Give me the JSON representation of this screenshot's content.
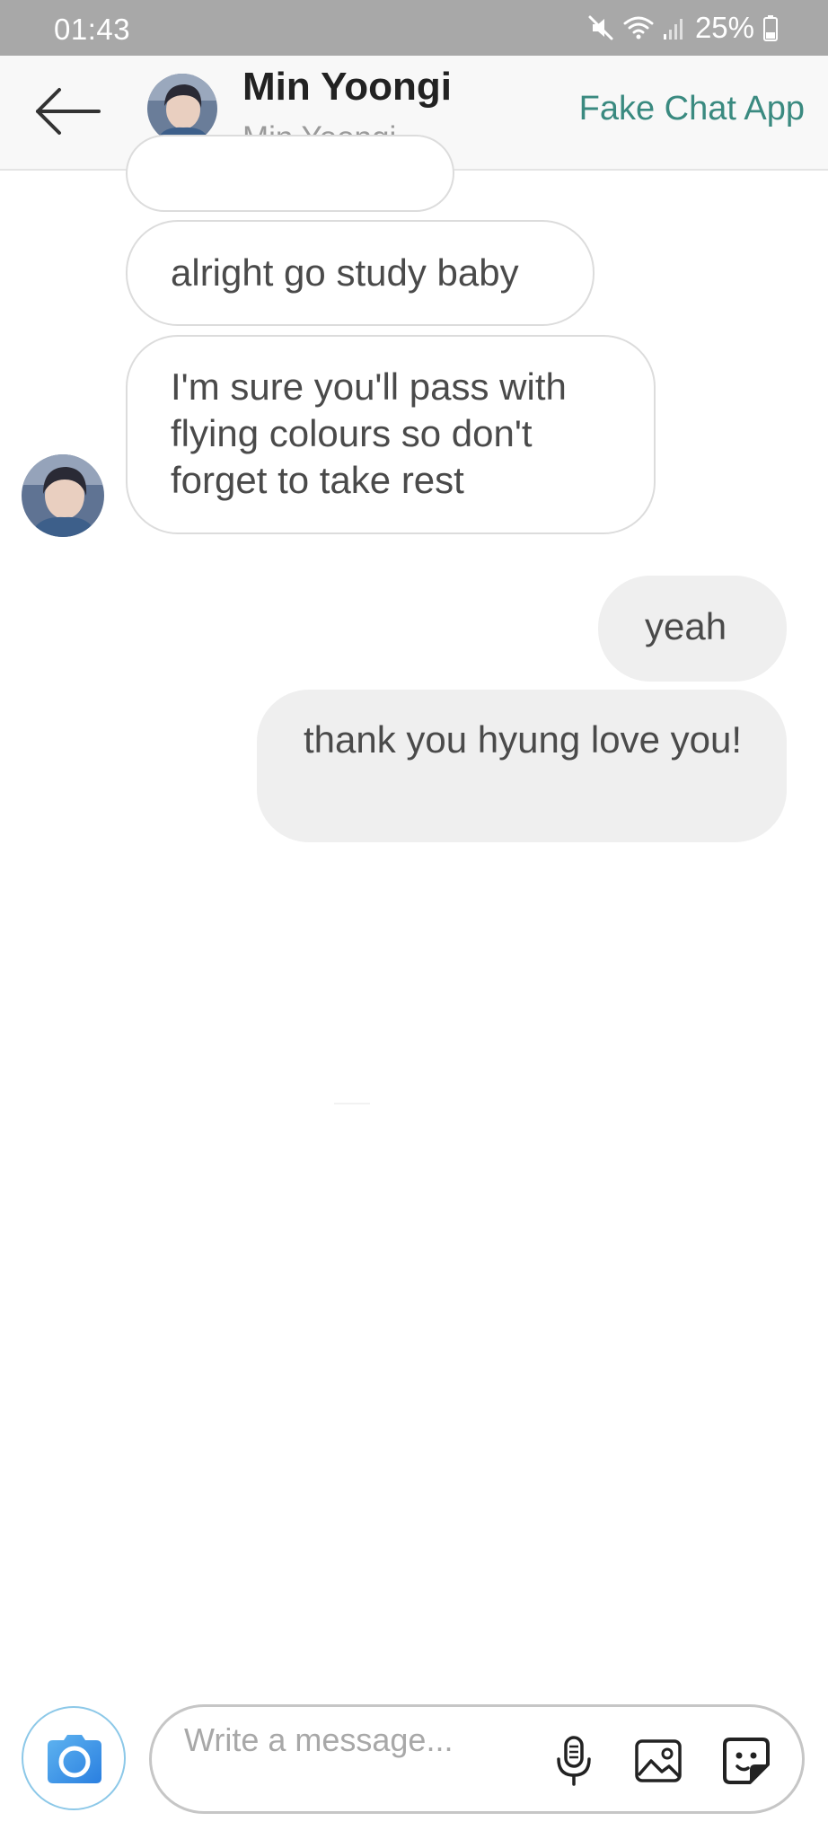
{
  "status_bar": {
    "time": "01:43",
    "battery": "25%",
    "icons": [
      "mute-icon",
      "wifi-icon",
      "signal-icon",
      "battery-icon"
    ]
  },
  "header": {
    "title": "Min Yoongi",
    "subtitle": "Min Yoongi",
    "app_label": "Fake Chat App",
    "back_icon": "arrow-left-icon"
  },
  "messages": [
    {
      "direction": "received",
      "text": ""
    },
    {
      "direction": "received",
      "text": "alright go study baby"
    },
    {
      "direction": "received",
      "text": "I'm sure you'll pass with flying colours so don't forget to take rest"
    },
    {
      "direction": "sent",
      "text": "yeah"
    },
    {
      "direction": "sent",
      "text": "thank you hyung love you!"
    }
  ],
  "composer": {
    "placeholder": "Write a message...",
    "value": "",
    "icons": [
      "camera-icon",
      "microphone-icon",
      "image-icon",
      "sticker-icon"
    ]
  },
  "colors": {
    "status_bar": "#a8a8a8",
    "header_bg": "#f8f8f8",
    "accent": "#3a8a80",
    "sent_bubble": "#efefef",
    "received_border": "#dcdcdc",
    "camera_blue": "#3a8fe8"
  }
}
